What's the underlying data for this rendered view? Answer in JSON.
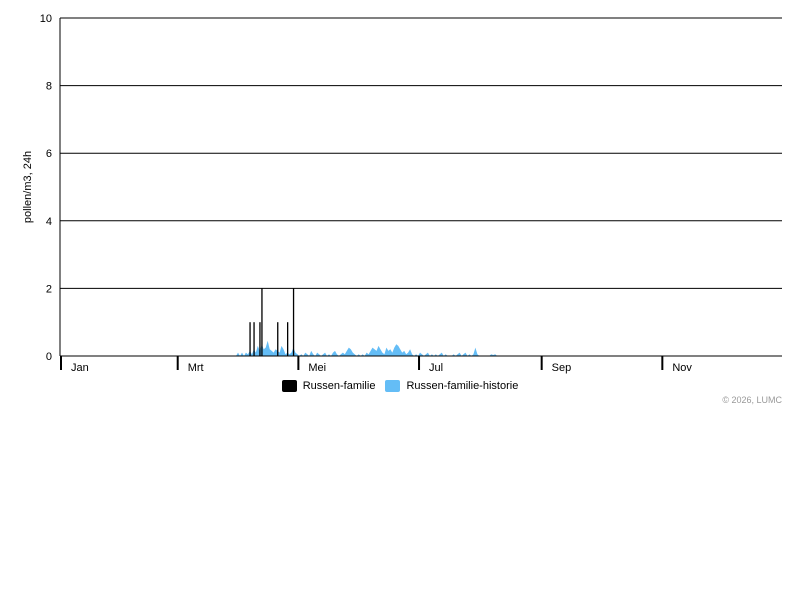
{
  "chart_data": {
    "type": "area",
    "ylabel": "pollen/m3, 24h",
    "ylim": [
      0,
      10
    ],
    "y_ticks": [
      "0",
      "2",
      "4",
      "6",
      "8",
      "10"
    ],
    "x_range_days": [
      1,
      366
    ],
    "month_ticks": [
      {
        "label": "Jan",
        "day": 1
      },
      {
        "label": "Mrt",
        "day": 60
      },
      {
        "label": "Mei",
        "day": 121
      },
      {
        "label": "Jul",
        "day": 182
      },
      {
        "label": "Sep",
        "day": 244
      },
      {
        "label": "Nov",
        "day": 305
      }
    ],
    "grid": true,
    "legend_position": "bottom-center",
    "series": [
      {
        "name": "Russen-familie",
        "type": "bar",
        "color": "#000000",
        "points": [
          [
            97,
            1
          ],
          [
            99,
            1
          ],
          [
            102,
            1
          ],
          [
            103,
            2
          ],
          [
            111,
            1
          ],
          [
            116,
            1
          ],
          [
            119,
            2
          ]
        ]
      },
      {
        "name": "Russen-familie-historie",
        "type": "area",
        "color": "#64bdf6",
        "points": [
          [
            90,
            0
          ],
          [
            91,
            0.1
          ],
          [
            92,
            0
          ],
          [
            93,
            0.1
          ],
          [
            94,
            0
          ],
          [
            95,
            0.1
          ],
          [
            96,
            0.05
          ],
          [
            97,
            0.15
          ],
          [
            98,
            0.05
          ],
          [
            99,
            0.2
          ],
          [
            100,
            0.1
          ],
          [
            101,
            0.3
          ],
          [
            102,
            0.15
          ],
          [
            103,
            0.35
          ],
          [
            104,
            0.2
          ],
          [
            105,
            0.25
          ],
          [
            106,
            0.45
          ],
          [
            107,
            0.2
          ],
          [
            108,
            0.15
          ],
          [
            109,
            0.1
          ],
          [
            110,
            0.2
          ],
          [
            111,
            0.15
          ],
          [
            112,
            0.1
          ],
          [
            113,
            0.3
          ],
          [
            114,
            0.2
          ],
          [
            115,
            0.05
          ],
          [
            116,
            0.1
          ],
          [
            117,
            0.05
          ],
          [
            118,
            0.1
          ],
          [
            119,
            0.25
          ],
          [
            120,
            0.1
          ],
          [
            121,
            0.05
          ],
          [
            122,
            0
          ],
          [
            123,
            0.05
          ],
          [
            124,
            0
          ],
          [
            125,
            0.1
          ],
          [
            126,
            0.05
          ],
          [
            127,
            0
          ],
          [
            128,
            0.15
          ],
          [
            129,
            0.05
          ],
          [
            130,
            0
          ],
          [
            131,
            0.1
          ],
          [
            132,
            0.05
          ],
          [
            133,
            0
          ],
          [
            134,
            0.05
          ],
          [
            135,
            0.1
          ],
          [
            136,
            0
          ],
          [
            137,
            0.05
          ],
          [
            138,
            0
          ],
          [
            139,
            0.1
          ],
          [
            140,
            0.15
          ],
          [
            141,
            0.05
          ],
          [
            142,
            0
          ],
          [
            143,
            0.05
          ],
          [
            144,
            0.1
          ],
          [
            145,
            0.05
          ],
          [
            146,
            0.15
          ],
          [
            147,
            0.25
          ],
          [
            148,
            0.2
          ],
          [
            149,
            0.1
          ],
          [
            150,
            0.05
          ],
          [
            151,
            0
          ],
          [
            152,
            0.05
          ],
          [
            153,
            0
          ],
          [
            154,
            0.05
          ],
          [
            155,
            0
          ],
          [
            156,
            0.1
          ],
          [
            157,
            0.05
          ],
          [
            158,
            0.15
          ],
          [
            159,
            0.25
          ],
          [
            160,
            0.2
          ],
          [
            161,
            0.15
          ],
          [
            162,
            0.3
          ],
          [
            163,
            0.2
          ],
          [
            164,
            0.1
          ],
          [
            165,
            0.05
          ],
          [
            166,
            0.25
          ],
          [
            167,
            0.15
          ],
          [
            168,
            0.2
          ],
          [
            169,
            0.1
          ],
          [
            170,
            0.25
          ],
          [
            171,
            0.35
          ],
          [
            172,
            0.3
          ],
          [
            173,
            0.2
          ],
          [
            174,
            0.1
          ],
          [
            175,
            0.15
          ],
          [
            176,
            0.05
          ],
          [
            177,
            0.1
          ],
          [
            178,
            0.2
          ],
          [
            179,
            0.05
          ],
          [
            180,
            0
          ],
          [
            181,
            0.05
          ],
          [
            182,
            0
          ],
          [
            183,
            0.1
          ],
          [
            184,
            0.05
          ],
          [
            185,
            0
          ],
          [
            186,
            0.05
          ],
          [
            187,
            0.1
          ],
          [
            188,
            0
          ],
          [
            189,
            0.05
          ],
          [
            190,
            0
          ],
          [
            191,
            0.05
          ],
          [
            192,
            0
          ],
          [
            193,
            0.05
          ],
          [
            194,
            0.1
          ],
          [
            195,
            0
          ],
          [
            196,
            0.05
          ],
          [
            197,
            0
          ],
          [
            198,
            0
          ],
          [
            199,
            0
          ],
          [
            200,
            0.05
          ],
          [
            201,
            0
          ],
          [
            202,
            0.05
          ],
          [
            203,
            0.1
          ],
          [
            204,
            0
          ],
          [
            205,
            0.05
          ],
          [
            206,
            0.1
          ],
          [
            207,
            0
          ],
          [
            208,
            0.05
          ],
          [
            209,
            0
          ],
          [
            210,
            0.05
          ],
          [
            211,
            0.25
          ],
          [
            212,
            0.05
          ],
          [
            213,
            0
          ],
          [
            214,
            0
          ],
          [
            215,
            0
          ],
          [
            216,
            0
          ],
          [
            217,
            0
          ],
          [
            218,
            0
          ],
          [
            219,
            0.05
          ],
          [
            220,
            0.03
          ],
          [
            221,
            0.05
          ],
          [
            222,
            0
          ]
        ]
      }
    ],
    "credit": "© 2026, LUMC"
  }
}
